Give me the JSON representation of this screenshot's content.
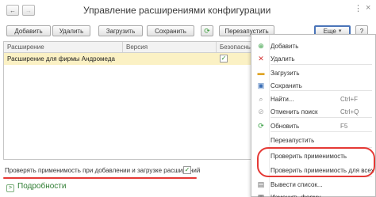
{
  "window": {
    "title": "Управление расширениями конфигурации",
    "menu_dots": "⋮",
    "close": "×"
  },
  "nav": {
    "back_glyph": "←",
    "forward_glyph": "→"
  },
  "toolbar": {
    "add": "Добавить",
    "delete": "Удалить",
    "load": "Загрузить",
    "save": "Сохранить",
    "refresh_glyph": "⟳",
    "restart": "Перезапустить",
    "more": "Еще",
    "more_arrow": "▾",
    "help": "?"
  },
  "table": {
    "columns": [
      "Расширение",
      "Версия",
      "Безопасный"
    ],
    "rows": [
      {
        "name": "Расширение для фирмы Андромеда",
        "version": "",
        "safe_mode": true
      }
    ]
  },
  "check_option": {
    "label": "Проверять применимость при добавлении и загрузке расширений",
    "checked": true
  },
  "details": {
    "label": "Подробности",
    "icon": ">"
  },
  "context_menu": {
    "items": [
      {
        "label": "Добавить",
        "shortcut": "",
        "icon": "plus-icon",
        "glyph": "⊕",
        "color": "#2e9b3a"
      },
      {
        "label": "Удалить",
        "shortcut": "",
        "icon": "delete-icon",
        "glyph": "✕",
        "color": "#d32f2f"
      },
      {
        "label": "Загрузить",
        "shortcut": "",
        "icon": "folder-icon",
        "glyph": "▬",
        "color": "#e0a526"
      },
      {
        "label": "Сохранить",
        "shortcut": "",
        "icon": "disk-icon",
        "glyph": "▣",
        "color": "#3b6fb6"
      },
      {
        "label": "Найти...",
        "shortcut": "Ctrl+F",
        "icon": "search-icon",
        "glyph": "⌕",
        "color": "#888888"
      },
      {
        "label": "Отменить поиск",
        "shortcut": "Ctrl+Q",
        "icon": "cancel-search-icon",
        "glyph": "⊘",
        "color": "#aaaaaa"
      },
      {
        "label": "Обновить",
        "shortcut": "F5",
        "icon": "refresh-icon",
        "glyph": "⟳",
        "color": "#2e9b3a"
      },
      {
        "label": "Перезапустить",
        "shortcut": "",
        "icon": "",
        "glyph": "",
        "color": "#333333"
      },
      {
        "label": "Проверить применимость",
        "shortcut": "",
        "icon": "",
        "glyph": "",
        "color": "#333333"
      },
      {
        "label": "Проверить применимость для всех",
        "shortcut": "",
        "icon": "",
        "glyph": "",
        "color": "#333333"
      },
      {
        "label": "Вывести список...",
        "shortcut": "",
        "icon": "list-icon",
        "glyph": "▤",
        "color": "#666666"
      },
      {
        "label": "Изменить форму...",
        "shortcut": "",
        "icon": "form-icon",
        "glyph": "▦",
        "color": "#666666"
      }
    ]
  },
  "colors": {
    "selected_row": "#fbf1c4",
    "highlight_red": "#e53935",
    "accent_green": "#2e7d32",
    "active_button_border": "#4a74b8"
  }
}
